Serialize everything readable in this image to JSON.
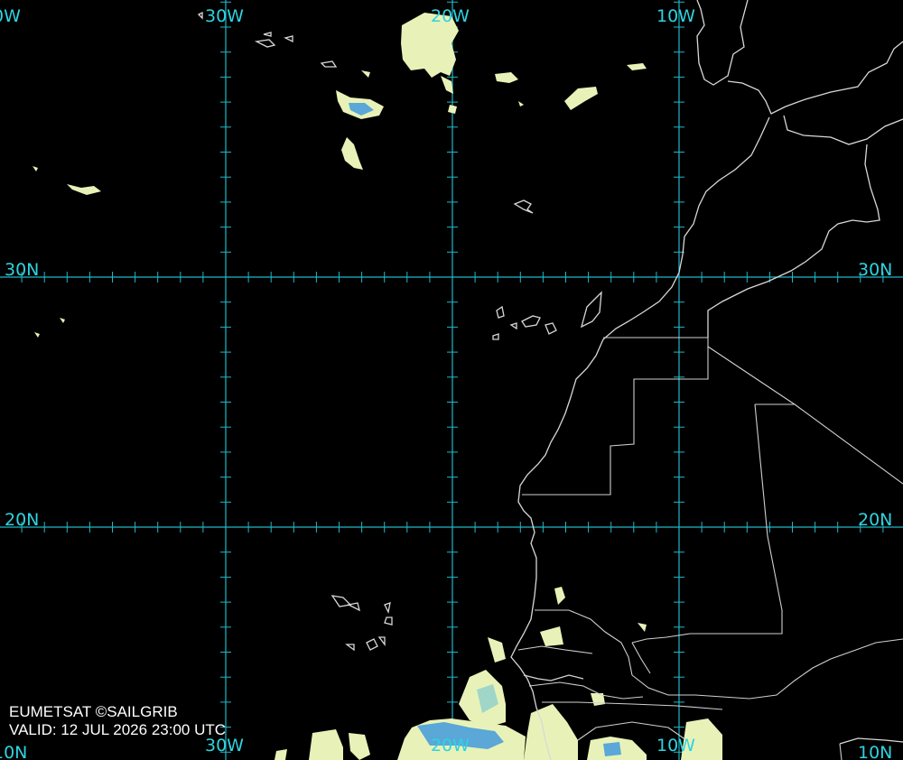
{
  "lon_labels": {
    "w40": "0W",
    "w30": "30W",
    "w20": "20W",
    "w10": "10W",
    "b40": "10N",
    "b30": "30W",
    "b20": "20W",
    "b10": "10W",
    "b0": "10N"
  },
  "lat_labels": {
    "left30": "30N",
    "right30": "30N",
    "left20": "20N",
    "right20": "20N"
  },
  "credit": "EUMETSAT ©SAILGRIB",
  "valid": "VALID:  12 JUL 2026 23:00 UTC",
  "colors": {
    "grid": "#1fb8c8",
    "grid_label": "#2fd3e0",
    "coast": "#d8d8d8",
    "cloud_warm": "#e8f2b8",
    "cloud_cold": "#5aa7d8"
  }
}
